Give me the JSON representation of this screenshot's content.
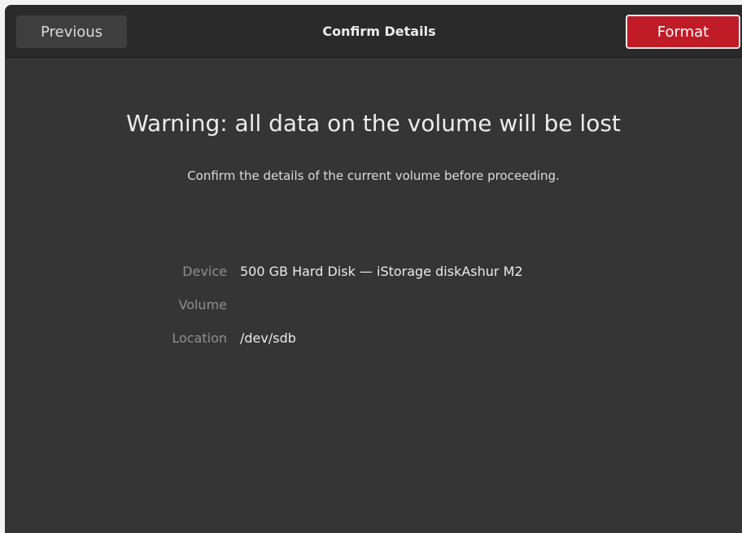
{
  "header": {
    "title": "Confirm Details",
    "previous_label": "Previous",
    "format_label": "Format"
  },
  "main": {
    "warning": "Warning: all data on the volume will be lost",
    "subtext": "Confirm the details of the current volume before proceeding."
  },
  "details": {
    "device": {
      "label": "Device",
      "value": "500 GB Hard Disk — iStorage diskAshur M2"
    },
    "volume": {
      "label": "Volume",
      "value": ""
    },
    "location": {
      "label": "Location",
      "value": "/dev/sdb"
    }
  },
  "colors": {
    "window_bg": "#353535",
    "headerbar_bg": "#2a2a2a",
    "destructive_accent": "#c01c28"
  }
}
